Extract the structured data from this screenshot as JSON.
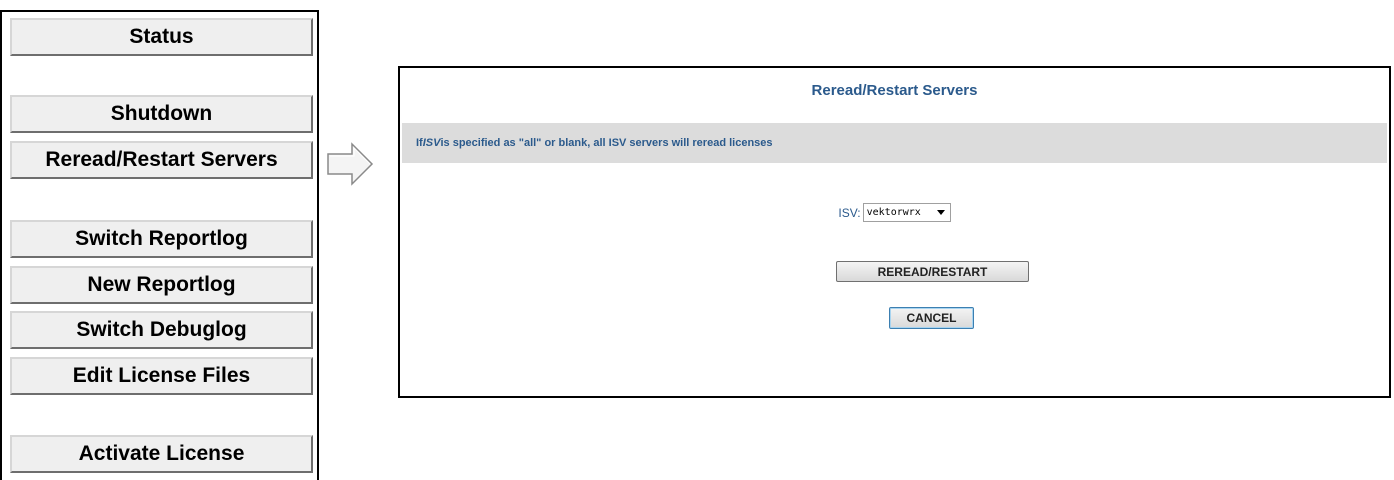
{
  "menu": {
    "items": [
      {
        "label": "Status"
      },
      {
        "label": "Shutdown"
      },
      {
        "label": "Reread/Restart Servers"
      },
      {
        "label": "Switch Reportlog"
      },
      {
        "label": "New Reportlog"
      },
      {
        "label": "Switch Debuglog"
      },
      {
        "label": "Edit License Files"
      },
      {
        "label": "Activate License"
      }
    ]
  },
  "arrow": {
    "icon": "right-arrow-icon"
  },
  "dialog": {
    "title": "Reread/Restart Servers",
    "info_prefix": "If ",
    "info_isv": "ISV",
    "info_suffix": " is specified as \"all\" or blank, all ISV servers will reread licenses",
    "isv_label": "ISV:",
    "isv_value": "vektorwrx",
    "reread_label": "REREAD/RESTART",
    "cancel_label": "CANCEL"
  },
  "colors": {
    "accent_text": "#2b5a8c",
    "info_bar_bg": "#dcdcdc",
    "menu_button_bg": "#efefef"
  }
}
